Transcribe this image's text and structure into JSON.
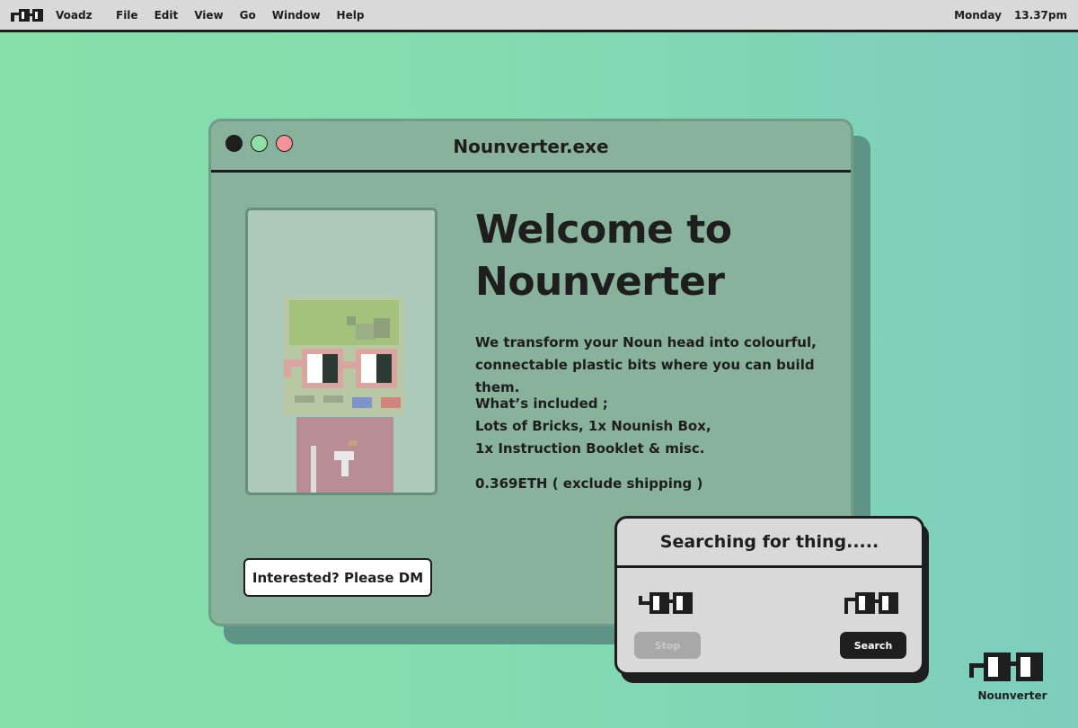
{
  "menubar": {
    "app_name": "Voadz",
    "menu_items": [
      "File",
      "Edit",
      "View",
      "Go",
      "Window",
      "Help"
    ],
    "day": "Monday",
    "time": "13.37pm"
  },
  "window": {
    "title": "Nounverter.exe",
    "heading_line1": "Welcome to",
    "heading_line2": "Nounverter",
    "description_line1": "We transform your Noun head into colourful,",
    "description_line2": "connectable plastic bits where you can build them.",
    "included_line1": "What’s included ;",
    "included_line2": "Lots of Bricks, 1x Nounish Box,",
    "included_line3": "1x Instruction Booklet & misc.",
    "price": "0.369ETH ( exclude shipping )",
    "cta_label": "Interested? Please DM"
  },
  "dialog": {
    "title": "Searching for thing.....",
    "stop_label": "Stop",
    "search_label": "Search"
  },
  "corner": {
    "label": "Nounverter"
  },
  "colors": {
    "background_left": "#86e0a8",
    "background_right": "#7ecdbd",
    "window_body": "#89b29c",
    "dot_green": "#8fe0a4",
    "dot_red": "#f2939a",
    "dark": "#1e1e1e",
    "panel_grey": "#d9d9d9"
  },
  "icons": {
    "menubar_logo": "noggles-icon",
    "dialog_left": "noggles-icon",
    "dialog_right": "noggles-icon",
    "corner_logo": "noggles-icon",
    "noun_image": "noun-avatar"
  }
}
